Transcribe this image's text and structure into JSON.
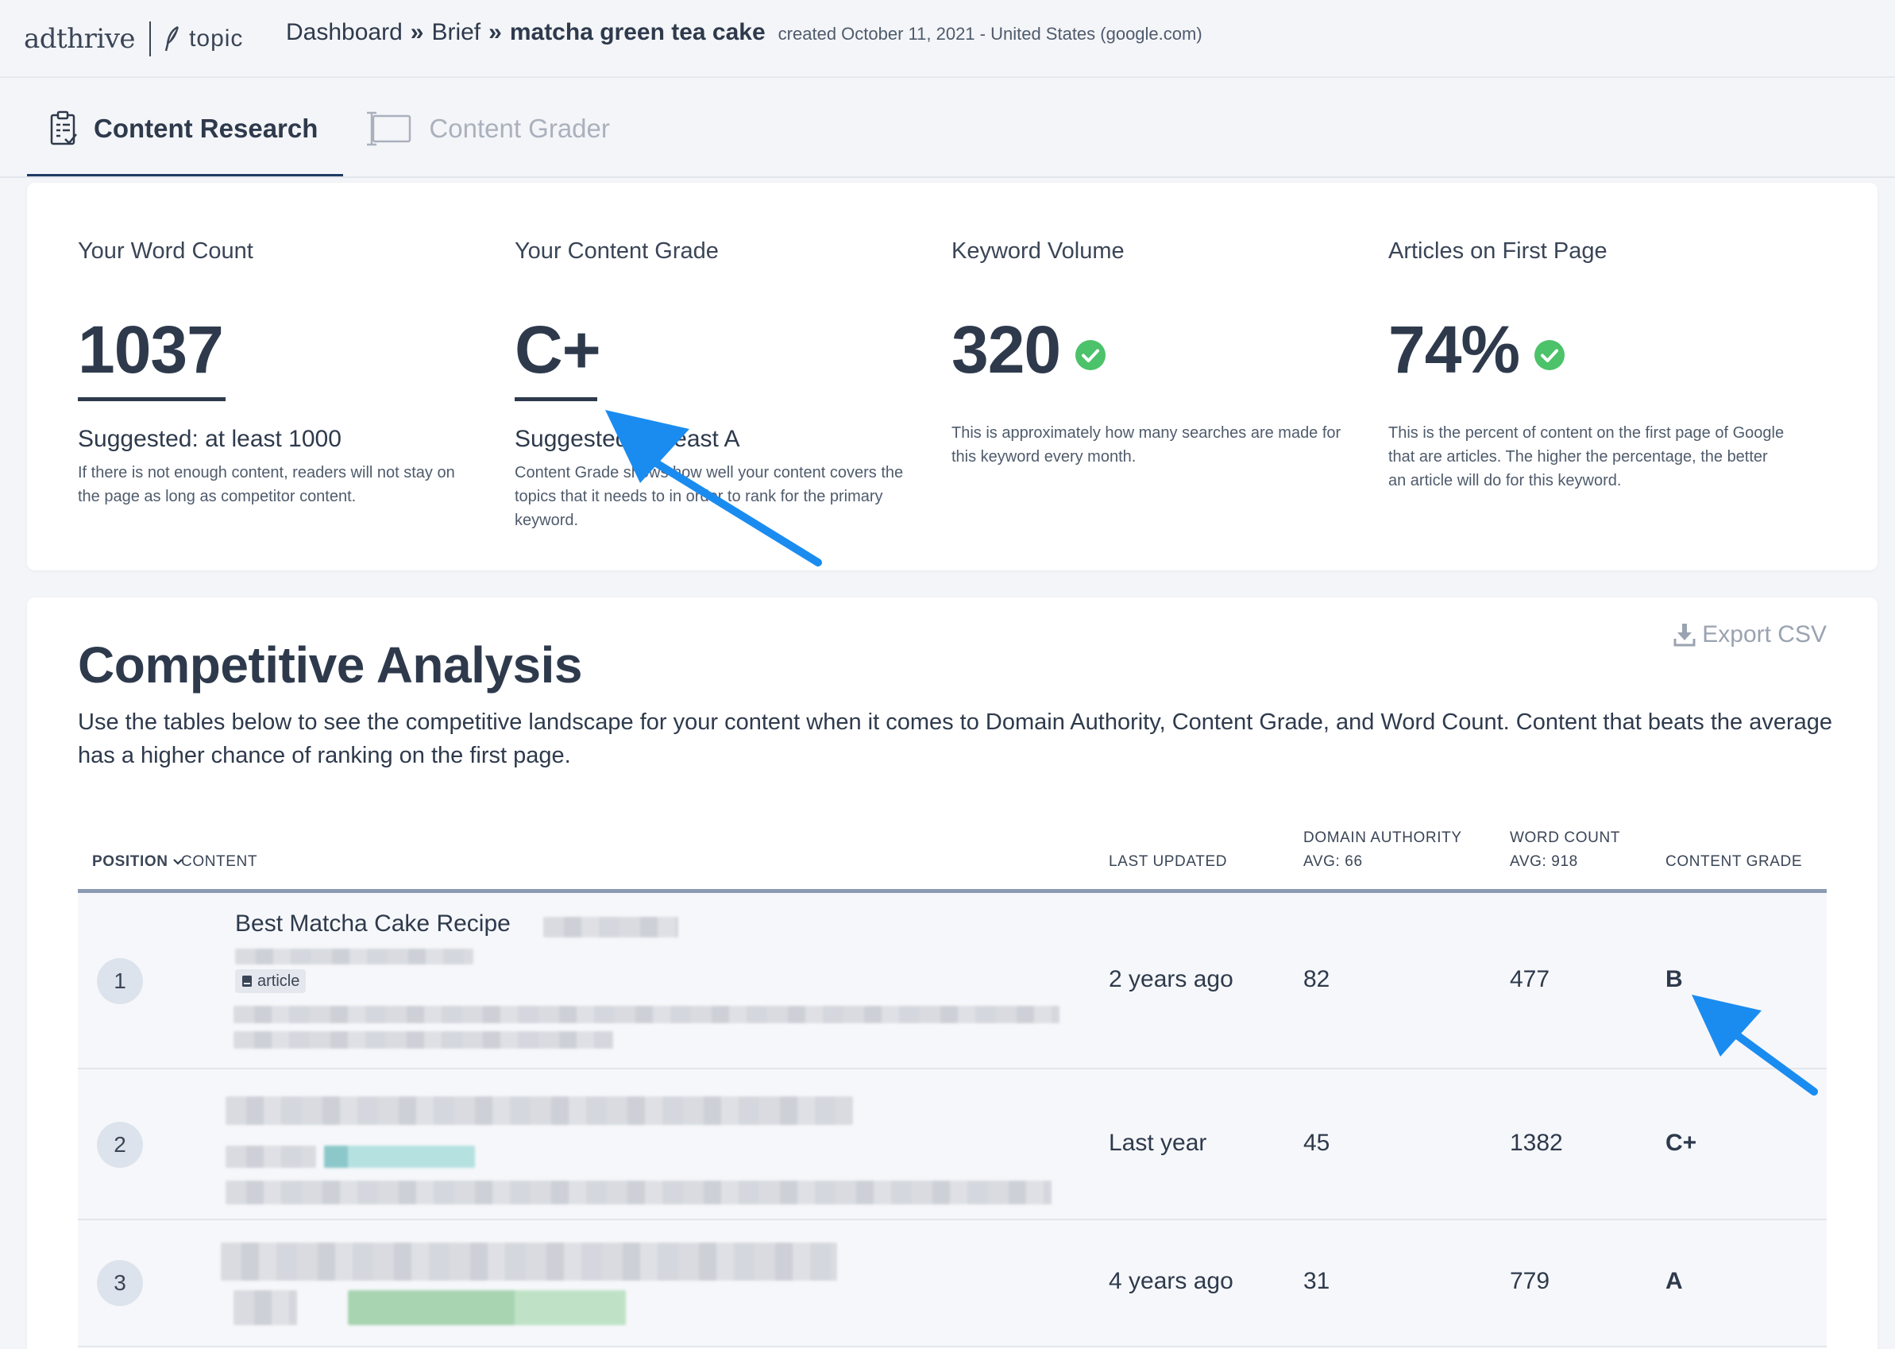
{
  "header": {
    "logo_text": "adthrive",
    "logo_product": "topic",
    "breadcrumb": {
      "dashboard": "Dashboard",
      "brief": "Brief",
      "current": "matcha green tea cake",
      "meta": "created October 11, 2021 - United States (google.com)"
    }
  },
  "tabs": [
    {
      "label": "Content Research",
      "active": true,
      "icon": "clipboard-check-icon"
    },
    {
      "label": "Content Grader",
      "active": false,
      "icon": "text-cursor-box-icon"
    }
  ],
  "metrics": {
    "word_count": {
      "title": "Your Word Count",
      "value": "1037",
      "suggested": "Suggested: at least 1000",
      "description": "If there is not enough content, readers will not stay on the page as long as competitor content."
    },
    "content_grade": {
      "title": "Your Content Grade",
      "value": "C+",
      "suggested": "Suggested: at least A",
      "description": "Content Grade shows how well your content covers the topics that it needs to in order to rank for the primary keyword."
    },
    "keyword_volume": {
      "title": "Keyword Volume",
      "value": "320",
      "description": "This is approximately how many searches are made for this keyword every month."
    },
    "articles_first_page": {
      "title": "Articles on First Page",
      "value": "74%",
      "description": "This is the percent of content on the first page of Google that are articles. The higher the percentage, the better an article will do for this keyword."
    }
  },
  "analysis": {
    "title": "Competitive Analysis",
    "export_label": "Export CSV",
    "description": "Use the tables below to see the competitive landscape for your content when it comes to Domain Authority, Content Grade, and Word Count. Content that beats the average has a higher chance of ranking on the first page.",
    "columns": {
      "position": "POSITION",
      "content": "CONTENT",
      "last_updated": "LAST UPDATED",
      "domain_authority": "DOMAIN AUTHORITY",
      "domain_authority_avg": "AVG: 66",
      "word_count": "WORD COUNT",
      "word_count_avg": "AVG: 918",
      "content_grade": "CONTENT GRADE"
    },
    "rows": [
      {
        "position": "1",
        "title": "Best Matcha Cake Recipe",
        "tag": "article",
        "last_updated": "2 years ago",
        "domain_authority": "82",
        "word_count": "477",
        "grade": "B"
      },
      {
        "position": "2",
        "last_updated": "Last year",
        "domain_authority": "45",
        "word_count": "1382",
        "grade": "C+"
      },
      {
        "position": "3",
        "last_updated": "4 years ago",
        "domain_authority": "31",
        "word_count": "779",
        "grade": "A"
      }
    ]
  },
  "colors": {
    "text_dark": "#2e3a4c",
    "check_green": "#4cc26a",
    "arrow_blue": "#1a8cf0",
    "tab_underline": "#1f3b63"
  }
}
